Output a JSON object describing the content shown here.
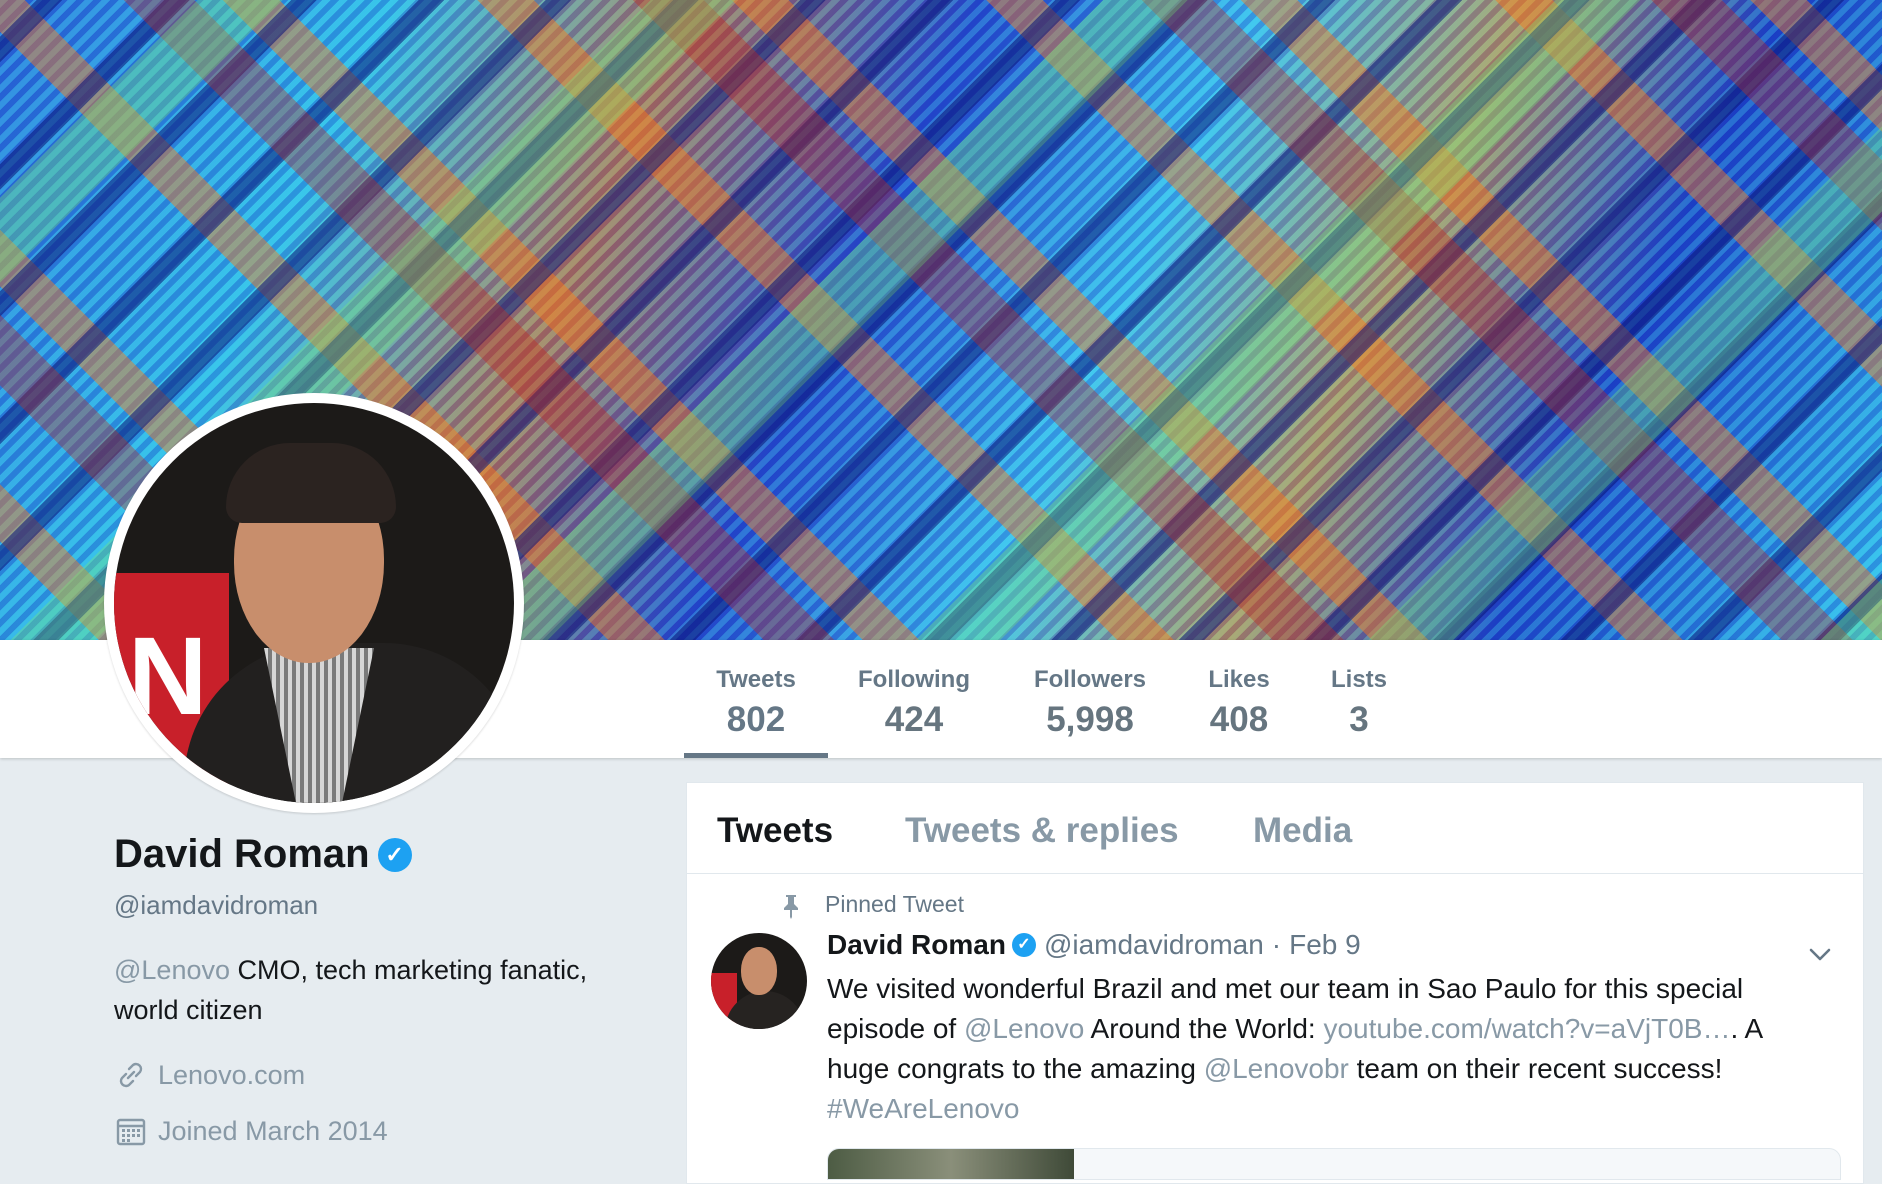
{
  "profile": {
    "name": "David Roman",
    "handle": "@iamdavidroman",
    "bio_mention": "@Lenovo",
    "bio_text": " CMO, tech marketing fanatic, world citizen",
    "url": "Lenovo.com",
    "joined": "Joined March 2014",
    "verified": true
  },
  "stats": [
    {
      "label": "Tweets",
      "value": "802"
    },
    {
      "label": "Following",
      "value": "424"
    },
    {
      "label": "Followers",
      "value": "5,998"
    },
    {
      "label": "Likes",
      "value": "408"
    },
    {
      "label": "Lists",
      "value": "3"
    }
  ],
  "timeline": {
    "tabs": [
      "Tweets",
      "Tweets & replies",
      "Media"
    ],
    "active_tab": "Tweets",
    "pinned_label": "Pinned Tweet",
    "tweet": {
      "name": "David Roman",
      "handle": "@iamdavidroman",
      "separator": "·",
      "date": "Feb 9",
      "text_1": "We visited wonderful Brazil and met our team in Sao Paulo for this special episode of ",
      "mention_1": "@Lenovo",
      "text_2": " Around the World: ",
      "link": "youtube.com/watch?v=aVjT0B…",
      "text_3": ". A huge congrats to the amazing ",
      "mention_2": "@Lenovobr",
      "text_4": " team on their recent success!",
      "hashtag": "#WeAreLenovo"
    }
  },
  "icons": [
    "verified-badge-icon",
    "link-icon",
    "calendar-icon",
    "pin-icon",
    "chevron-down-icon"
  ],
  "colors": {
    "accent_verified": "#1da1f2",
    "muted_text": "#657786",
    "link_text": "#8899a6",
    "page_background": "#e6ecf0"
  }
}
